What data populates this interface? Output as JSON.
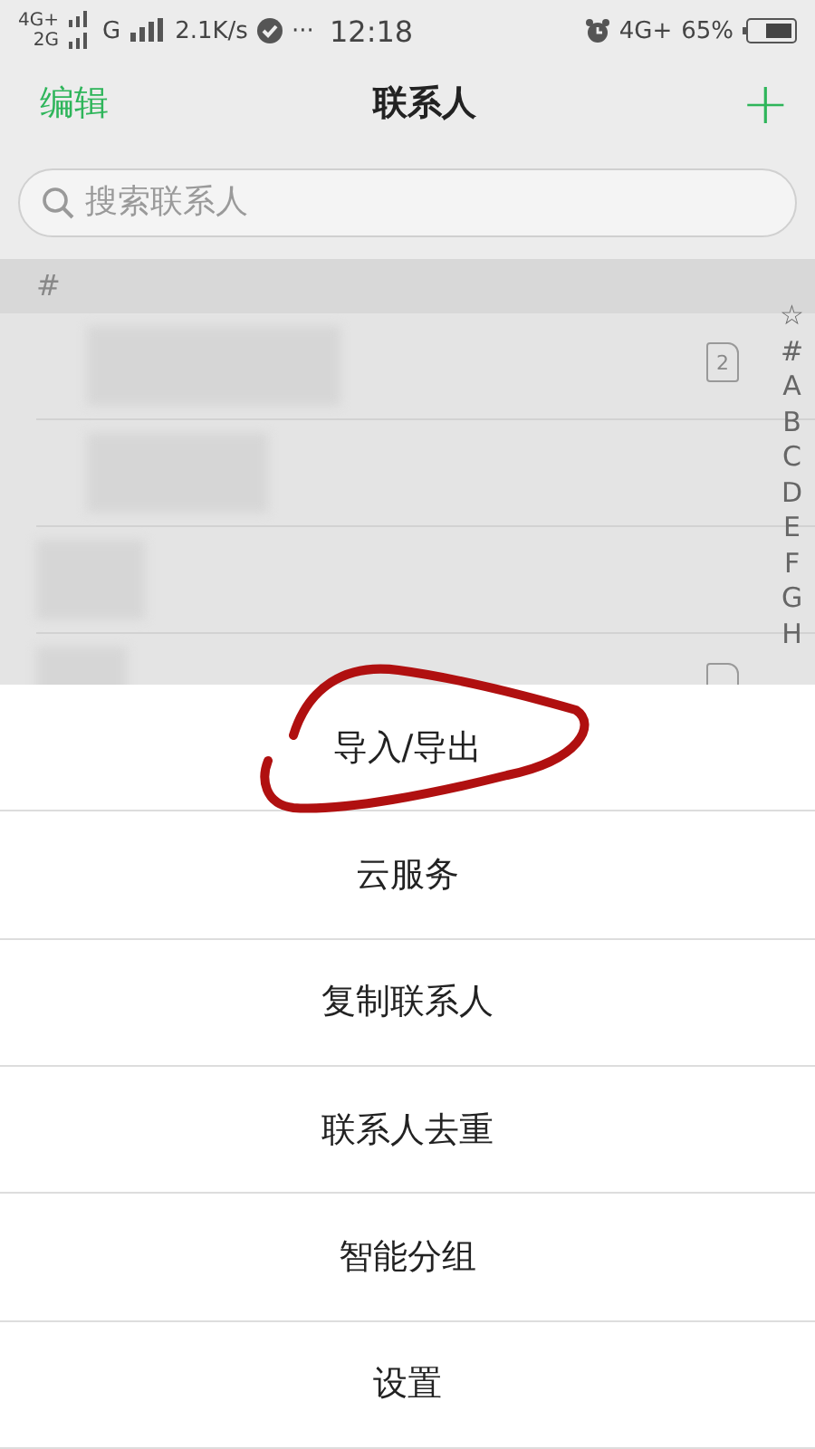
{
  "status_bar": {
    "network_1": "4G+",
    "network_2": "2G",
    "network_3": "G",
    "speed": "2.1K/s",
    "more": "···",
    "time": "12:18",
    "network_4": "4G+",
    "battery": "65%"
  },
  "header": {
    "left": "编辑",
    "title": "联系人",
    "add": "+"
  },
  "search": {
    "placeholder": "搜索联系人"
  },
  "section": "#",
  "contacts": [
    {
      "kind": "redacted",
      "sim_card": true,
      "sim_slot": "2"
    },
    {
      "kind": "redacted",
      "sim_card": false
    },
    {
      "kind": "redacted",
      "sim_card": false
    },
    {
      "kind": "redacted",
      "sim_card": true
    }
  ],
  "index_letters": [
    "☆",
    "#",
    "A",
    "B",
    "C",
    "D",
    "E",
    "F",
    "G",
    "H"
  ],
  "menu": [
    {
      "label": "导入/导出",
      "circled": true
    },
    {
      "label": "云服务",
      "circled": false
    },
    {
      "label": "复制联系人",
      "circled": false
    },
    {
      "label": "联系人去重",
      "circled": false
    },
    {
      "label": "智能分组",
      "circled": false
    },
    {
      "label": "设置",
      "circled": false
    }
  ]
}
